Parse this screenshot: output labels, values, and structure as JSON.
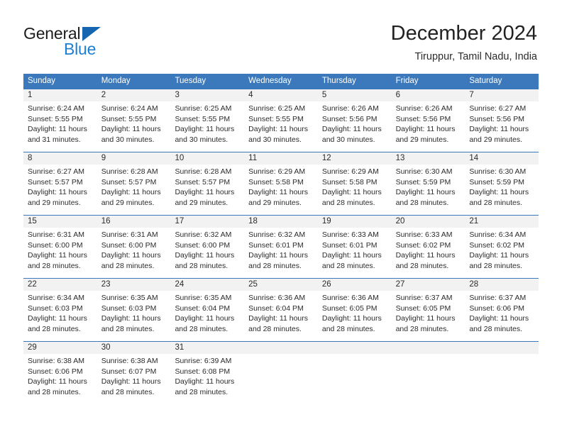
{
  "logo": {
    "word_top": "General",
    "word_bottom": "Blue",
    "triangle_icon": "blue-triangle-icon",
    "blue": "#1d7fd4",
    "dark_blue": "#1565b0"
  },
  "header": {
    "title": "December 2024",
    "subtitle": "Tiruppur, Tamil Nadu, India"
  },
  "colors": {
    "header_blue": "#3b79bc",
    "daynum_band": "#f2f2f2",
    "text": "#2b2b2b"
  },
  "weekdays": [
    "Sunday",
    "Monday",
    "Tuesday",
    "Wednesday",
    "Thursday",
    "Friday",
    "Saturday"
  ],
  "weeks": [
    [
      {
        "day": "1",
        "sunrise": "Sunrise: 6:24 AM",
        "sunset": "Sunset: 5:55 PM",
        "daylight1": "Daylight: 11 hours",
        "daylight2": "and 31 minutes."
      },
      {
        "day": "2",
        "sunrise": "Sunrise: 6:24 AM",
        "sunset": "Sunset: 5:55 PM",
        "daylight1": "Daylight: 11 hours",
        "daylight2": "and 30 minutes."
      },
      {
        "day": "3",
        "sunrise": "Sunrise: 6:25 AM",
        "sunset": "Sunset: 5:55 PM",
        "daylight1": "Daylight: 11 hours",
        "daylight2": "and 30 minutes."
      },
      {
        "day": "4",
        "sunrise": "Sunrise: 6:25 AM",
        "sunset": "Sunset: 5:55 PM",
        "daylight1": "Daylight: 11 hours",
        "daylight2": "and 30 minutes."
      },
      {
        "day": "5",
        "sunrise": "Sunrise: 6:26 AM",
        "sunset": "Sunset: 5:56 PM",
        "daylight1": "Daylight: 11 hours",
        "daylight2": "and 30 minutes."
      },
      {
        "day": "6",
        "sunrise": "Sunrise: 6:26 AM",
        "sunset": "Sunset: 5:56 PM",
        "daylight1": "Daylight: 11 hours",
        "daylight2": "and 29 minutes."
      },
      {
        "day": "7",
        "sunrise": "Sunrise: 6:27 AM",
        "sunset": "Sunset: 5:56 PM",
        "daylight1": "Daylight: 11 hours",
        "daylight2": "and 29 minutes."
      }
    ],
    [
      {
        "day": "8",
        "sunrise": "Sunrise: 6:27 AM",
        "sunset": "Sunset: 5:57 PM",
        "daylight1": "Daylight: 11 hours",
        "daylight2": "and 29 minutes."
      },
      {
        "day": "9",
        "sunrise": "Sunrise: 6:28 AM",
        "sunset": "Sunset: 5:57 PM",
        "daylight1": "Daylight: 11 hours",
        "daylight2": "and 29 minutes."
      },
      {
        "day": "10",
        "sunrise": "Sunrise: 6:28 AM",
        "sunset": "Sunset: 5:57 PM",
        "daylight1": "Daylight: 11 hours",
        "daylight2": "and 29 minutes."
      },
      {
        "day": "11",
        "sunrise": "Sunrise: 6:29 AM",
        "sunset": "Sunset: 5:58 PM",
        "daylight1": "Daylight: 11 hours",
        "daylight2": "and 29 minutes."
      },
      {
        "day": "12",
        "sunrise": "Sunrise: 6:29 AM",
        "sunset": "Sunset: 5:58 PM",
        "daylight1": "Daylight: 11 hours",
        "daylight2": "and 28 minutes."
      },
      {
        "day": "13",
        "sunrise": "Sunrise: 6:30 AM",
        "sunset": "Sunset: 5:59 PM",
        "daylight1": "Daylight: 11 hours",
        "daylight2": "and 28 minutes."
      },
      {
        "day": "14",
        "sunrise": "Sunrise: 6:30 AM",
        "sunset": "Sunset: 5:59 PM",
        "daylight1": "Daylight: 11 hours",
        "daylight2": "and 28 minutes."
      }
    ],
    [
      {
        "day": "15",
        "sunrise": "Sunrise: 6:31 AM",
        "sunset": "Sunset: 6:00 PM",
        "daylight1": "Daylight: 11 hours",
        "daylight2": "and 28 minutes."
      },
      {
        "day": "16",
        "sunrise": "Sunrise: 6:31 AM",
        "sunset": "Sunset: 6:00 PM",
        "daylight1": "Daylight: 11 hours",
        "daylight2": "and 28 minutes."
      },
      {
        "day": "17",
        "sunrise": "Sunrise: 6:32 AM",
        "sunset": "Sunset: 6:00 PM",
        "daylight1": "Daylight: 11 hours",
        "daylight2": "and 28 minutes."
      },
      {
        "day": "18",
        "sunrise": "Sunrise: 6:32 AM",
        "sunset": "Sunset: 6:01 PM",
        "daylight1": "Daylight: 11 hours",
        "daylight2": "and 28 minutes."
      },
      {
        "day": "19",
        "sunrise": "Sunrise: 6:33 AM",
        "sunset": "Sunset: 6:01 PM",
        "daylight1": "Daylight: 11 hours",
        "daylight2": "and 28 minutes."
      },
      {
        "day": "20",
        "sunrise": "Sunrise: 6:33 AM",
        "sunset": "Sunset: 6:02 PM",
        "daylight1": "Daylight: 11 hours",
        "daylight2": "and 28 minutes."
      },
      {
        "day": "21",
        "sunrise": "Sunrise: 6:34 AM",
        "sunset": "Sunset: 6:02 PM",
        "daylight1": "Daylight: 11 hours",
        "daylight2": "and 28 minutes."
      }
    ],
    [
      {
        "day": "22",
        "sunrise": "Sunrise: 6:34 AM",
        "sunset": "Sunset: 6:03 PM",
        "daylight1": "Daylight: 11 hours",
        "daylight2": "and 28 minutes."
      },
      {
        "day": "23",
        "sunrise": "Sunrise: 6:35 AM",
        "sunset": "Sunset: 6:03 PM",
        "daylight1": "Daylight: 11 hours",
        "daylight2": "and 28 minutes."
      },
      {
        "day": "24",
        "sunrise": "Sunrise: 6:35 AM",
        "sunset": "Sunset: 6:04 PM",
        "daylight1": "Daylight: 11 hours",
        "daylight2": "and 28 minutes."
      },
      {
        "day": "25",
        "sunrise": "Sunrise: 6:36 AM",
        "sunset": "Sunset: 6:04 PM",
        "daylight1": "Daylight: 11 hours",
        "daylight2": "and 28 minutes."
      },
      {
        "day": "26",
        "sunrise": "Sunrise: 6:36 AM",
        "sunset": "Sunset: 6:05 PM",
        "daylight1": "Daylight: 11 hours",
        "daylight2": "and 28 minutes."
      },
      {
        "day": "27",
        "sunrise": "Sunrise: 6:37 AM",
        "sunset": "Sunset: 6:05 PM",
        "daylight1": "Daylight: 11 hours",
        "daylight2": "and 28 minutes."
      },
      {
        "day": "28",
        "sunrise": "Sunrise: 6:37 AM",
        "sunset": "Sunset: 6:06 PM",
        "daylight1": "Daylight: 11 hours",
        "daylight2": "and 28 minutes."
      }
    ],
    [
      {
        "day": "29",
        "sunrise": "Sunrise: 6:38 AM",
        "sunset": "Sunset: 6:06 PM",
        "daylight1": "Daylight: 11 hours",
        "daylight2": "and 28 minutes."
      },
      {
        "day": "30",
        "sunrise": "Sunrise: 6:38 AM",
        "sunset": "Sunset: 6:07 PM",
        "daylight1": "Daylight: 11 hours",
        "daylight2": "and 28 minutes."
      },
      {
        "day": "31",
        "sunrise": "Sunrise: 6:39 AM",
        "sunset": "Sunset: 6:08 PM",
        "daylight1": "Daylight: 11 hours",
        "daylight2": "and 28 minutes."
      },
      {
        "day": "",
        "sunrise": "",
        "sunset": "",
        "daylight1": "",
        "daylight2": ""
      },
      {
        "day": "",
        "sunrise": "",
        "sunset": "",
        "daylight1": "",
        "daylight2": ""
      },
      {
        "day": "",
        "sunrise": "",
        "sunset": "",
        "daylight1": "",
        "daylight2": ""
      },
      {
        "day": "",
        "sunrise": "",
        "sunset": "",
        "daylight1": "",
        "daylight2": ""
      }
    ]
  ]
}
